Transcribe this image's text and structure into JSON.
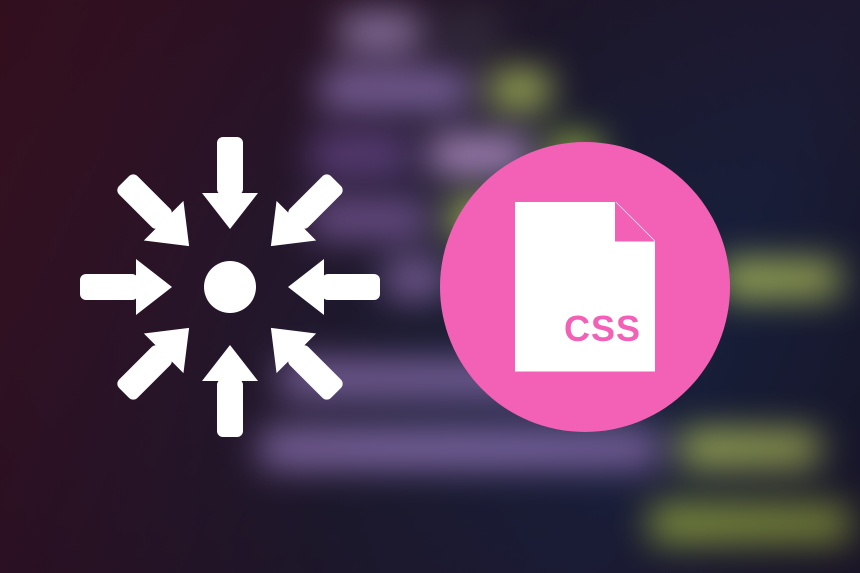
{
  "badge": {
    "label": "CSS",
    "circle_color": "#f261b5",
    "file_color": "#ffffff"
  },
  "icons": {
    "converge": "inward-arrows-icon",
    "file": "css-file-icon"
  }
}
